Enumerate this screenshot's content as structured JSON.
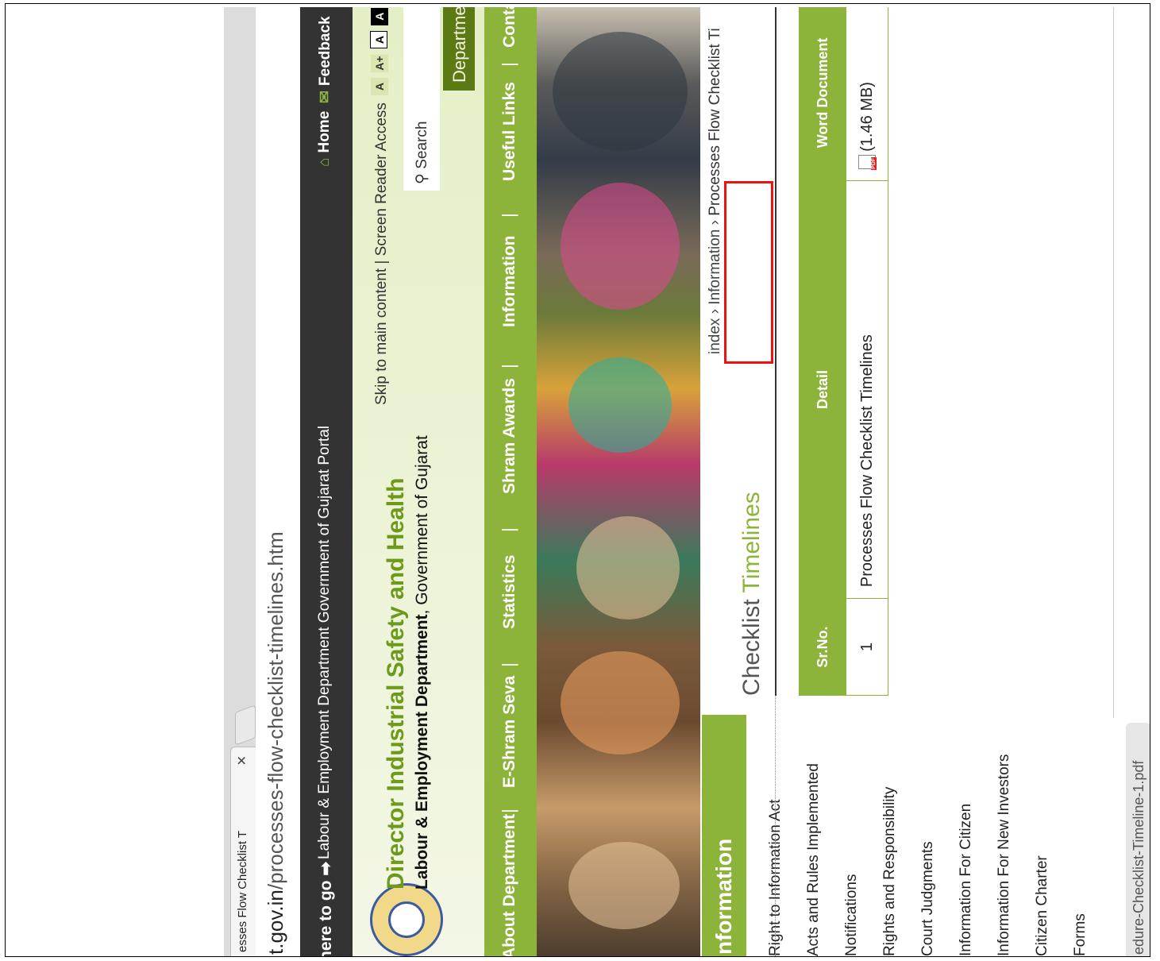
{
  "browser": {
    "tab_title": "esses Flow Checklist T",
    "tab_close": "✕",
    "url_domain": "t.gov.in",
    "url_path": "/processes-flow-checklist-timelines.htm"
  },
  "topbar": {
    "where_to_go": "here to go",
    "arrow": "➡",
    "portal_link": "Labour & Employment Department Government of Gujarat Portal",
    "home": "Home",
    "feedback": "Feedback"
  },
  "header": {
    "title": "Director Industrial Safety and Health",
    "subtitle_bold": "Labour & Employment Department",
    "subtitle_rest": ", Government of Gujarat",
    "skip_to_main": "Skip to main content",
    "divider": "|",
    "screen_reader": "Screen Reader Access",
    "font_small": "A",
    "font_large": "A+",
    "contrast_1": "A",
    "contrast_2": "A",
    "search_placeholder": "Search",
    "department_button": "Departmer"
  },
  "nav": {
    "items": [
      "About Department",
      "E-Shram Seva",
      "Statistics",
      "Shram Awards",
      "Information",
      "Useful Links",
      "Conta"
    ],
    "separator": "|"
  },
  "sidebar": {
    "heading": "nformation",
    "items": [
      "Right to Information Act",
      "Acts and Rules Implemented",
      "Notifications",
      "Rights and Responsibility",
      "Court Judgments",
      "Information For Citizen",
      "Information For New Investors",
      "Citizen Charter",
      "Forms"
    ]
  },
  "breadcrumb": {
    "items": [
      "index",
      "Information",
      "Processes Flow Checklist Ti"
    ],
    "separator": "›"
  },
  "content": {
    "title_part1": "Checklist",
    "title_part2": "Timelines",
    "table": {
      "headers": [
        "Sr.No.",
        "Detail",
        "Word Document"
      ],
      "rows": [
        {
          "sr": "1",
          "detail": "Processes Flow Checklist Timelines",
          "doc_size": "(1.46 MB)"
        }
      ]
    }
  },
  "download_bar": {
    "file": "edure-Checklist-Timeline-1.pdf"
  },
  "colors": {
    "accent_green": "#8cb43a",
    "dark_bar": "#333333",
    "highlight_box": "#ee1111"
  }
}
